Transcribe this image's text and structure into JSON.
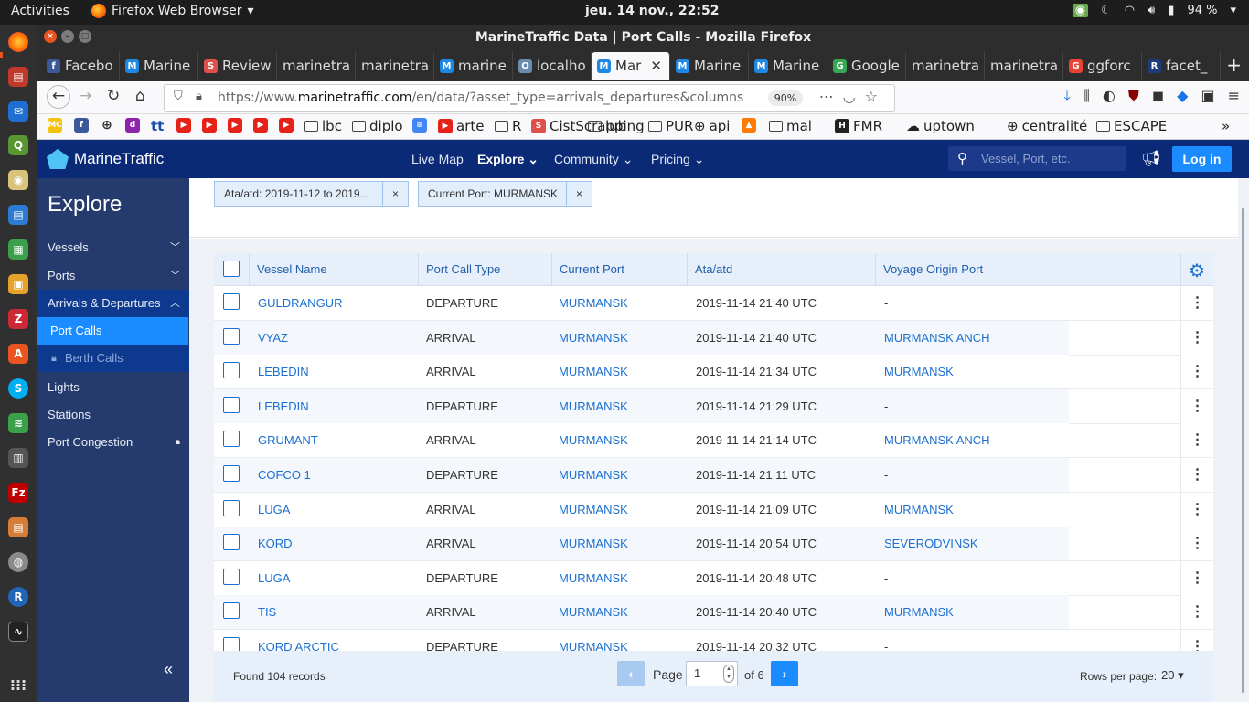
{
  "system": {
    "activities": "Activities",
    "app_name": "Firefox Web Browser",
    "clock": "jeu. 14 nov., 22:52",
    "battery": "94 %"
  },
  "window": {
    "title": "MarineTraffic Data | Port Calls - Mozilla Firefox"
  },
  "tabs": [
    {
      "label": "Facebo",
      "fav": "f",
      "color": "#3b5998"
    },
    {
      "label": "Marine",
      "fav": "M",
      "color": "#1e88e5"
    },
    {
      "label": "Review",
      "fav": "S",
      "color": "#e0504a"
    },
    {
      "label": "marinetra",
      "fav": "",
      "color": ""
    },
    {
      "label": "marinetra",
      "fav": "",
      "color": ""
    },
    {
      "label": "marine",
      "fav": "M",
      "color": "#1e88e5"
    },
    {
      "label": "localho",
      "fav": "O",
      "color": "#6a8cae"
    },
    {
      "label": "Mar",
      "fav": "M",
      "color": "#1e88e5"
    },
    {
      "label": "Marine",
      "fav": "M",
      "color": "#1e88e5"
    },
    {
      "label": "Marine",
      "fav": "M",
      "color": "#1e88e5"
    },
    {
      "label": "Google",
      "fav": "G",
      "color": "#34a853"
    },
    {
      "label": "marinetra",
      "fav": "",
      "color": ""
    },
    {
      "label": "marinetra",
      "fav": "",
      "color": ""
    },
    {
      "label": "ggforc",
      "fav": "G",
      "color": "#ea4335"
    },
    {
      "label": "facet_",
      "fav": "R",
      "color": "#1c3c7a"
    }
  ],
  "urlbar": {
    "url_prefix": "https://www.",
    "url_domain": "marinetraffic.com",
    "url_rest": "/en/data/?asset_type=arrivals_departures&columns",
    "zoom": "90%"
  },
  "bookmarks": [
    {
      "label": "MC",
      "kind": "icon",
      "color": "#f4c20d"
    },
    {
      "label": "f",
      "kind": "icon",
      "color": "#3b5998"
    },
    {
      "label": "⊕",
      "kind": "glyph",
      "color": ""
    },
    {
      "label": "d",
      "kind": "icon",
      "color": "#8e24aa"
    },
    {
      "label": "tt",
      "kind": "text",
      "color": ""
    },
    {
      "label": "▶",
      "kind": "icon",
      "color": "#e62117"
    },
    {
      "label": "▶",
      "kind": "icon",
      "color": "#e62117"
    },
    {
      "label": "▶",
      "kind": "icon",
      "color": "#e62117"
    },
    {
      "label": "▶",
      "kind": "icon",
      "color": "#e62117"
    },
    {
      "label": "▶",
      "kind": "icon",
      "color": "#e62117"
    },
    {
      "label": "lbc",
      "kind": "folder",
      "color": ""
    },
    {
      "label": "diplo",
      "kind": "folder",
      "color": ""
    },
    {
      "label": "≡",
      "kind": "icon",
      "color": "#4285f4"
    },
    {
      "label": "arte",
      "kind": "yt",
      "color": "#e62117"
    },
    {
      "label": "R",
      "kind": "folder",
      "color": ""
    },
    {
      "label": "CistScrapping",
      "kind": "s",
      "color": "#e0504a"
    },
    {
      "label": "lub",
      "kind": "folder",
      "color": ""
    },
    {
      "label": "PUR",
      "kind": "folder",
      "color": ""
    },
    {
      "label": "api",
      "kind": "globe",
      "color": ""
    },
    {
      "label": "▲",
      "kind": "icon",
      "color": "#ff7a00"
    },
    {
      "label": "mal",
      "kind": "folder",
      "color": ""
    },
    {
      "label": "FMR",
      "kind": "hal",
      "color": ""
    },
    {
      "label": "uptown",
      "kind": "cloud",
      "color": ""
    },
    {
      "label": "centralité",
      "kind": "globe",
      "color": ""
    },
    {
      "label": "ESCAPE",
      "kind": "folder",
      "color": ""
    }
  ],
  "header": {
    "logo_text": "MarineTraffic",
    "nav": [
      "Live Map",
      "Explore",
      "Community",
      "Pricing"
    ],
    "search_placeholder": "Vessel, Port, etc.",
    "login_label": "Log in"
  },
  "sidebar": {
    "title": "Explore",
    "items": [
      {
        "label": "Vessels"
      },
      {
        "label": "Ports"
      },
      {
        "label": "Arrivals & Departures"
      },
      {
        "label": "Port Calls"
      },
      {
        "label": "Berth Calls"
      },
      {
        "label": "Lights"
      },
      {
        "label": "Stations"
      },
      {
        "label": "Port Congestion"
      }
    ]
  },
  "filters": [
    {
      "label": "Ata/atd: 2019-11-12 to 2019..."
    },
    {
      "label": "Current Port: MURMANSK"
    }
  ],
  "table": {
    "columns": [
      "Vessel Name",
      "Port Call Type",
      "Current Port",
      "Ata/atd",
      "Voyage Origin Port"
    ],
    "rows": [
      {
        "vessel": "GULDRANGUR",
        "type": "DEPARTURE",
        "port": "MURMANSK",
        "time": "2019-11-14 21:40 UTC",
        "origin": "-"
      },
      {
        "vessel": "VYAZ",
        "type": "ARRIVAL",
        "port": "MURMANSK",
        "time": "2019-11-14 21:40 UTC",
        "origin": "MURMANSK ANCH"
      },
      {
        "vessel": "LEBEDIN",
        "type": "ARRIVAL",
        "port": "MURMANSK",
        "time": "2019-11-14 21:34 UTC",
        "origin": "MURMANSK"
      },
      {
        "vessel": "LEBEDIN",
        "type": "DEPARTURE",
        "port": "MURMANSK",
        "time": "2019-11-14 21:29 UTC",
        "origin": "-"
      },
      {
        "vessel": "GRUMANT",
        "type": "ARRIVAL",
        "port": "MURMANSK",
        "time": "2019-11-14 21:14 UTC",
        "origin": "MURMANSK ANCH"
      },
      {
        "vessel": "COFCO 1",
        "type": "DEPARTURE",
        "port": "MURMANSK",
        "time": "2019-11-14 21:11 UTC",
        "origin": "-"
      },
      {
        "vessel": "LUGA",
        "type": "ARRIVAL",
        "port": "MURMANSK",
        "time": "2019-11-14 21:09 UTC",
        "origin": "MURMANSK"
      },
      {
        "vessel": "KORD",
        "type": "ARRIVAL",
        "port": "MURMANSK",
        "time": "2019-11-14 20:54 UTC",
        "origin": "SEVERODVINSK"
      },
      {
        "vessel": "LUGA",
        "type": "DEPARTURE",
        "port": "MURMANSK",
        "time": "2019-11-14 20:48 UTC",
        "origin": "-"
      },
      {
        "vessel": "TIS",
        "type": "ARRIVAL",
        "port": "MURMANSK",
        "time": "2019-11-14 20:40 UTC",
        "origin": "MURMANSK"
      },
      {
        "vessel": "KORD ARCTIC",
        "type": "DEPARTURE",
        "port": "MURMANSK",
        "time": "2019-11-14 20:32 UTC",
        "origin": "-"
      }
    ]
  },
  "pager": {
    "found": "Found 104 records",
    "page_label": "Page",
    "page_value": "1",
    "of_label": "of 6",
    "rows_label": "Rows per page:",
    "rows_value": "20"
  }
}
